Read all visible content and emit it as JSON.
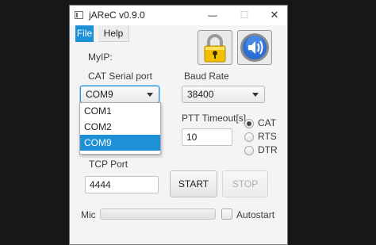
{
  "window": {
    "title": "jAReC v0.9.0",
    "controls": {
      "minimize": "—",
      "maximize": "☐",
      "close": "✕"
    }
  },
  "menu": {
    "file": "File",
    "help": "Help"
  },
  "labels": {
    "myip": "MyIP:",
    "cat_serial_port": "CAT Serial port",
    "baud_rate": "Baud Rate",
    "ptt_timeout": "PTT Timeout[s]",
    "tcp_port": "TCP Port",
    "mic": "Mic",
    "autostart": "Autostart"
  },
  "cat_serial_port": {
    "selected": "COM9",
    "options": [
      "COM1",
      "COM2",
      "COM9"
    ],
    "highlighted_index": 2
  },
  "baud_rate": {
    "selected": "38400"
  },
  "ptt_timeout": {
    "value": "10"
  },
  "tcp_port": {
    "value": "4444"
  },
  "ptt_mode": {
    "options": [
      "CAT",
      "RTS",
      "DTR"
    ],
    "selected": "CAT"
  },
  "buttons": {
    "start": "START",
    "stop": "STOP"
  },
  "icons": {
    "lock": "padlock-icon",
    "speaker": "speaker-icon"
  },
  "mic_level": 0,
  "autostart_checked": false,
  "colors": {
    "accent": "#1e90d8",
    "lock_gold": "#f2c000",
    "speaker_blue": "#2a6fd6"
  }
}
